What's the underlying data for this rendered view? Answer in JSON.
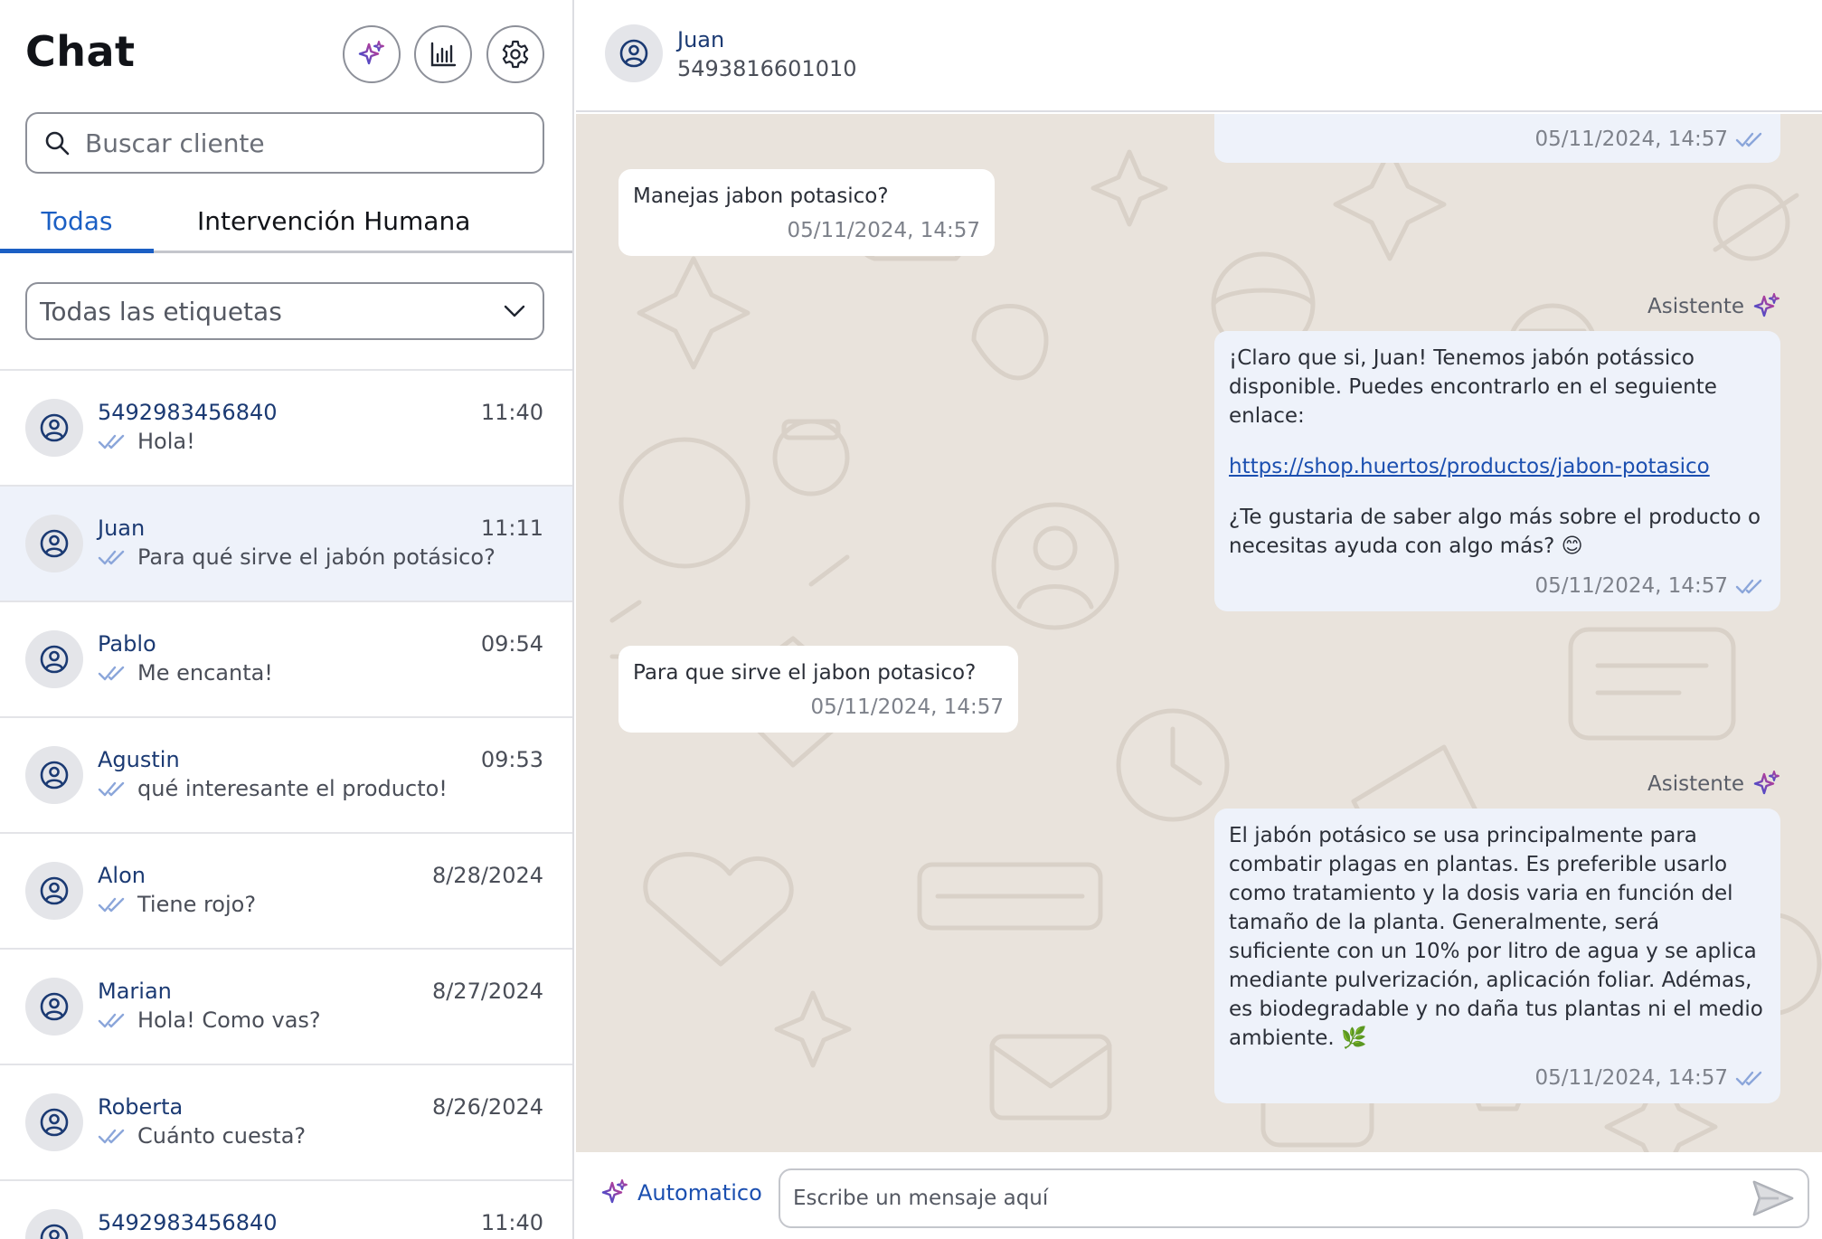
{
  "sidebar": {
    "title": "Chat",
    "search": {
      "placeholder": "Buscar cliente"
    },
    "tabs": [
      {
        "label": "Todas"
      },
      {
        "label": "Intervención Humana"
      }
    ],
    "tag_filter": {
      "selected": "Todas las etiquetas"
    },
    "chats": [
      {
        "name": "5492983456840",
        "time": "11:40",
        "last_message": "Hola!"
      },
      {
        "name": "Juan",
        "time": "11:11",
        "last_message": "Para qué sirve el jabón potásico?"
      },
      {
        "name": "Pablo",
        "time": "09:54",
        "last_message": "Me encanta!"
      },
      {
        "name": "Agustin",
        "time": "09:53",
        "last_message": "qué interesante el producto!"
      },
      {
        "name": "Alon",
        "time": "8/28/2024",
        "last_message": "Tiene rojo?"
      },
      {
        "name": "Marian",
        "time": "8/27/2024",
        "last_message": "Hola! Como vas?"
      },
      {
        "name": "Roberta",
        "time": "8/26/2024",
        "last_message": "Cuánto cuesta?"
      },
      {
        "name": "5492983456840",
        "time": "11:40",
        "last_message": ""
      }
    ]
  },
  "conversation": {
    "contact_name": "Juan",
    "contact_phone": "5493816601010",
    "messages": [
      {
        "direction": "outgoing",
        "time": "05/11/2024, 14:57"
      },
      {
        "direction": "incoming",
        "text": "Manejas jabon potasico?",
        "time": "05/11/2024, 14:57"
      },
      {
        "direction": "outgoing",
        "sender": "Asistente",
        "line1": "¡Claro que si, Juan! Tenemos jabón potássico disponible. Puedes encontrarlo en el seguiente enlace:",
        "link": "https://shop.huertos/productos/jabon-potasico",
        "line2": "¿Te gustaria de saber algo más sobre el producto o necesitas ayuda con algo más? 😊",
        "time": "05/11/2024, 14:57"
      },
      {
        "direction": "incoming",
        "text": "Para que sirve el jabon potasico?",
        "time": "05/11/2024, 14:57"
      },
      {
        "direction": "outgoing",
        "sender": "Asistente",
        "text": "El jabón potásico se usa principalmente para combatir plagas en plantas. Es preferible usarlo como tratamiento y la dosis varia en función del tamaño de la planta. Generalmente, será suficiente con un 10% por litro de agua y se aplica mediante pulverización, aplicación foliar. Adémas, es biodegradable y no daña  tus plantas ni el medio ambiente. 🌿",
        "time": "05/11/2024, 14:57"
      }
    ]
  },
  "composer": {
    "mode_label": "Automatico",
    "placeholder": "Escribe un mensaje aquí"
  },
  "colors": {
    "accent": "#1b5fc4",
    "link": "#1b4fb0",
    "wallpaper": "#e9e3dc",
    "outgoing_bubble": "#eef2fa",
    "active_row": "#eef2fa"
  },
  "icons": [
    "sparkle-icon",
    "bar-chart-icon",
    "gear-icon",
    "search-icon",
    "chevron-down-icon",
    "user-avatar-icon",
    "double-check-icon",
    "send-icon"
  ]
}
